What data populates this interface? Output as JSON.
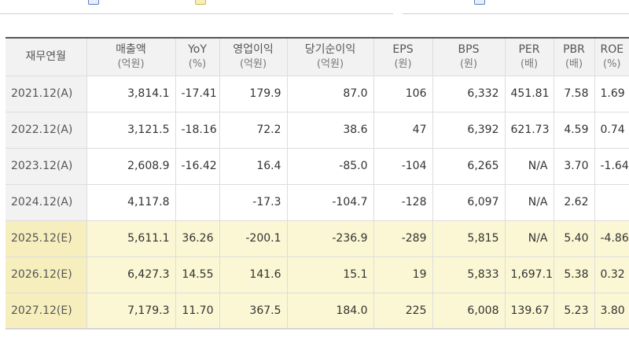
{
  "table": {
    "headers": [
      {
        "label": "재무연월",
        "unit": ""
      },
      {
        "label": "매출액",
        "unit": "(억원)"
      },
      {
        "label": "YoY",
        "unit": "(%)"
      },
      {
        "label": "영업이익",
        "unit": "(억원)"
      },
      {
        "label": "당기순이익",
        "unit": "(억원)"
      },
      {
        "label": "EPS",
        "unit": "(원)"
      },
      {
        "label": "BPS",
        "unit": "(원)"
      },
      {
        "label": "PER",
        "unit": "(배)"
      },
      {
        "label": "PBR",
        "unit": "(배)"
      },
      {
        "label": "ROE",
        "unit": "(%)"
      }
    ],
    "rows": [
      {
        "period": "2021.12(A)",
        "cells": [
          "3,814.1",
          "-17.41",
          "179.9",
          "87.0",
          "106",
          "6,332",
          "451.81",
          "7.58",
          "1.69"
        ],
        "estimate": false
      },
      {
        "period": "2022.12(A)",
        "cells": [
          "3,121.5",
          "-18.16",
          "72.2",
          "38.6",
          "47",
          "6,392",
          "621.73",
          "4.59",
          "0.74"
        ],
        "estimate": false
      },
      {
        "period": "2023.12(A)",
        "cells": [
          "2,608.9",
          "-16.42",
          "16.4",
          "-85.0",
          "-104",
          "6,265",
          "N/A",
          "3.70",
          "-1.64"
        ],
        "estimate": false
      },
      {
        "period": "2024.12(A)",
        "cells": [
          "4,117.8",
          "",
          "-17.3",
          "-104.7",
          "-128",
          "6,097",
          "N/A",
          "2.62",
          ""
        ],
        "estimate": false
      },
      {
        "period": "2025.12(E)",
        "cells": [
          "5,611.1",
          "36.26",
          "-200.1",
          "-236.9",
          "-289",
          "5,815",
          "N/A",
          "5.40",
          "-4.86"
        ],
        "estimate": true
      },
      {
        "period": "2026.12(E)",
        "cells": [
          "6,427.3",
          "14.55",
          "141.6",
          "15.1",
          "19",
          "5,833",
          "1,697.11",
          "5.38",
          "0.32"
        ],
        "estimate": true
      },
      {
        "period": "2027.12(E)",
        "cells": [
          "7,179.3",
          "11.70",
          "367.5",
          "184.0",
          "225",
          "6,008",
          "139.67",
          "5.23",
          "3.80"
        ],
        "estimate": true
      }
    ]
  },
  "colors": {
    "header_bg": "#f2f2f2",
    "estimate_bg": "#fbf6d3",
    "border": "#dddddd"
  }
}
